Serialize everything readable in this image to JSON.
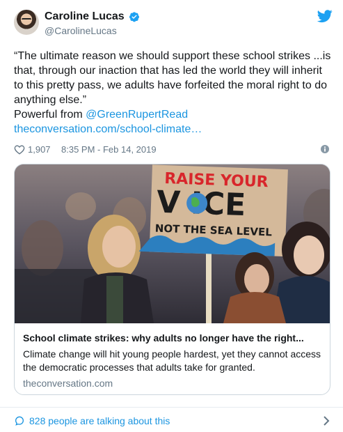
{
  "author": {
    "name": "Caroline Lucas",
    "handle": "@CarolineLucas",
    "verified": true
  },
  "tweet": {
    "quote": "“The ultimate reason we should support these school strikes ...is that, through our inaction that has led the world they will inherit to this pretty pass, we adults have forfeited the moral right to do anything else.”",
    "powerful_from": "Powerful from ",
    "mention": "@GreenRupertRead",
    "url": "theconversation.com/school-climate…"
  },
  "meta": {
    "likes": "1,907",
    "timestamp": "8:35 PM - Feb 14, 2019"
  },
  "link_card": {
    "sign_line1": "RAISE YOUR",
    "sign_line2": "V   ICE",
    "sign_line3": "NOT THE SEA LEVEL",
    "title": "School climate strikes: why adults no longer have the right...",
    "description": "Climate change will hit young people hardest, yet they cannot access the democratic processes that adults take for granted.",
    "domain": "theconversation.com"
  },
  "footer": {
    "talking": "828 people are talking about this"
  },
  "colors": {
    "link": "#1b95e0",
    "verified": "#1da1f2",
    "heart": "#657786",
    "text": "#14171a",
    "secondary": "#657786"
  },
  "icons": [
    "verified-badge-icon",
    "twitter-bird-icon",
    "heart-icon",
    "info-icon",
    "speech-bubble-icon",
    "chevron-right-icon"
  ]
}
